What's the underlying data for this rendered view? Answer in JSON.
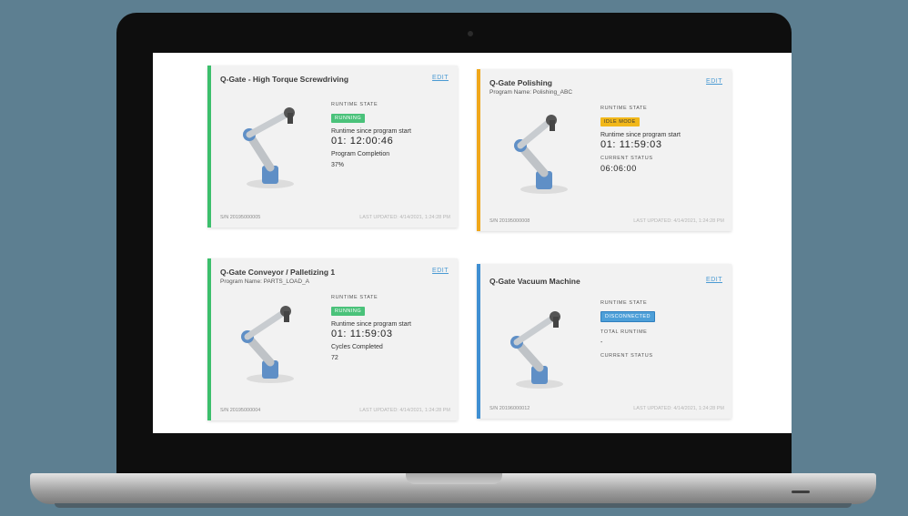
{
  "cards": [
    {
      "title": "Q-Gate - High Torque Screwdriving",
      "edit": "EDIT",
      "state_label": "RUNTIME STATE",
      "state": "RUNNING",
      "runtime_label": "Runtime since program start",
      "runtime": "01: 12:00:46",
      "metric_label": "Program Completion",
      "metric_value": "37%",
      "serial": "S/N 20195000005",
      "updated": "LAST UPDATED: 4/14/2021, 1:24:28 PM"
    },
    {
      "title": "Q-Gate Polishing",
      "subtitle": "Program Name: Polishing_ABC",
      "edit": "EDIT",
      "state_label": "RUNTIME STATE",
      "state": "IDLE MODE",
      "runtime_label": "Runtime since program start",
      "runtime": "01: 11:59:03",
      "metric_label": "CURRENT STATUS",
      "metric_value": "06:06:00",
      "serial": "S/N 20195000008",
      "updated": "LAST UPDATED: 4/14/2021, 1:24:28 PM"
    },
    {
      "title": "Q-Gate Conveyor / Palletizing 1",
      "subtitle": "Program Name: PARTS_LOAD_A",
      "edit": "EDIT",
      "state_label": "RUNTIME STATE",
      "state": "RUNNING",
      "runtime_label": "Runtime since program start",
      "runtime": "01: 11:59:03",
      "metric_label": "Cycles Completed",
      "metric_value": "72",
      "serial": "S/N 20195000004",
      "updated": "LAST UPDATED: 4/14/2021, 1:24:28 PM"
    },
    {
      "title": "Q-Gate Vacuum Machine",
      "edit": "EDIT",
      "state_label": "RUNTIME STATE",
      "state": "DISCONNECTED",
      "runtime_label": "TOTAL RUNTIME",
      "runtime": "-",
      "metric_label": "CURRENT STATUS",
      "metric_value": "",
      "serial": "S/N 20196000012",
      "updated": "LAST UPDATED: 4/14/2021, 1:24:28 PM"
    }
  ],
  "colors": {
    "running": "#4ac27a",
    "idle": "#f2b81a",
    "disconnected": "#4d9fd8",
    "background": "#5d7f91"
  },
  "icons": [
    "robot-arm-image"
  ]
}
